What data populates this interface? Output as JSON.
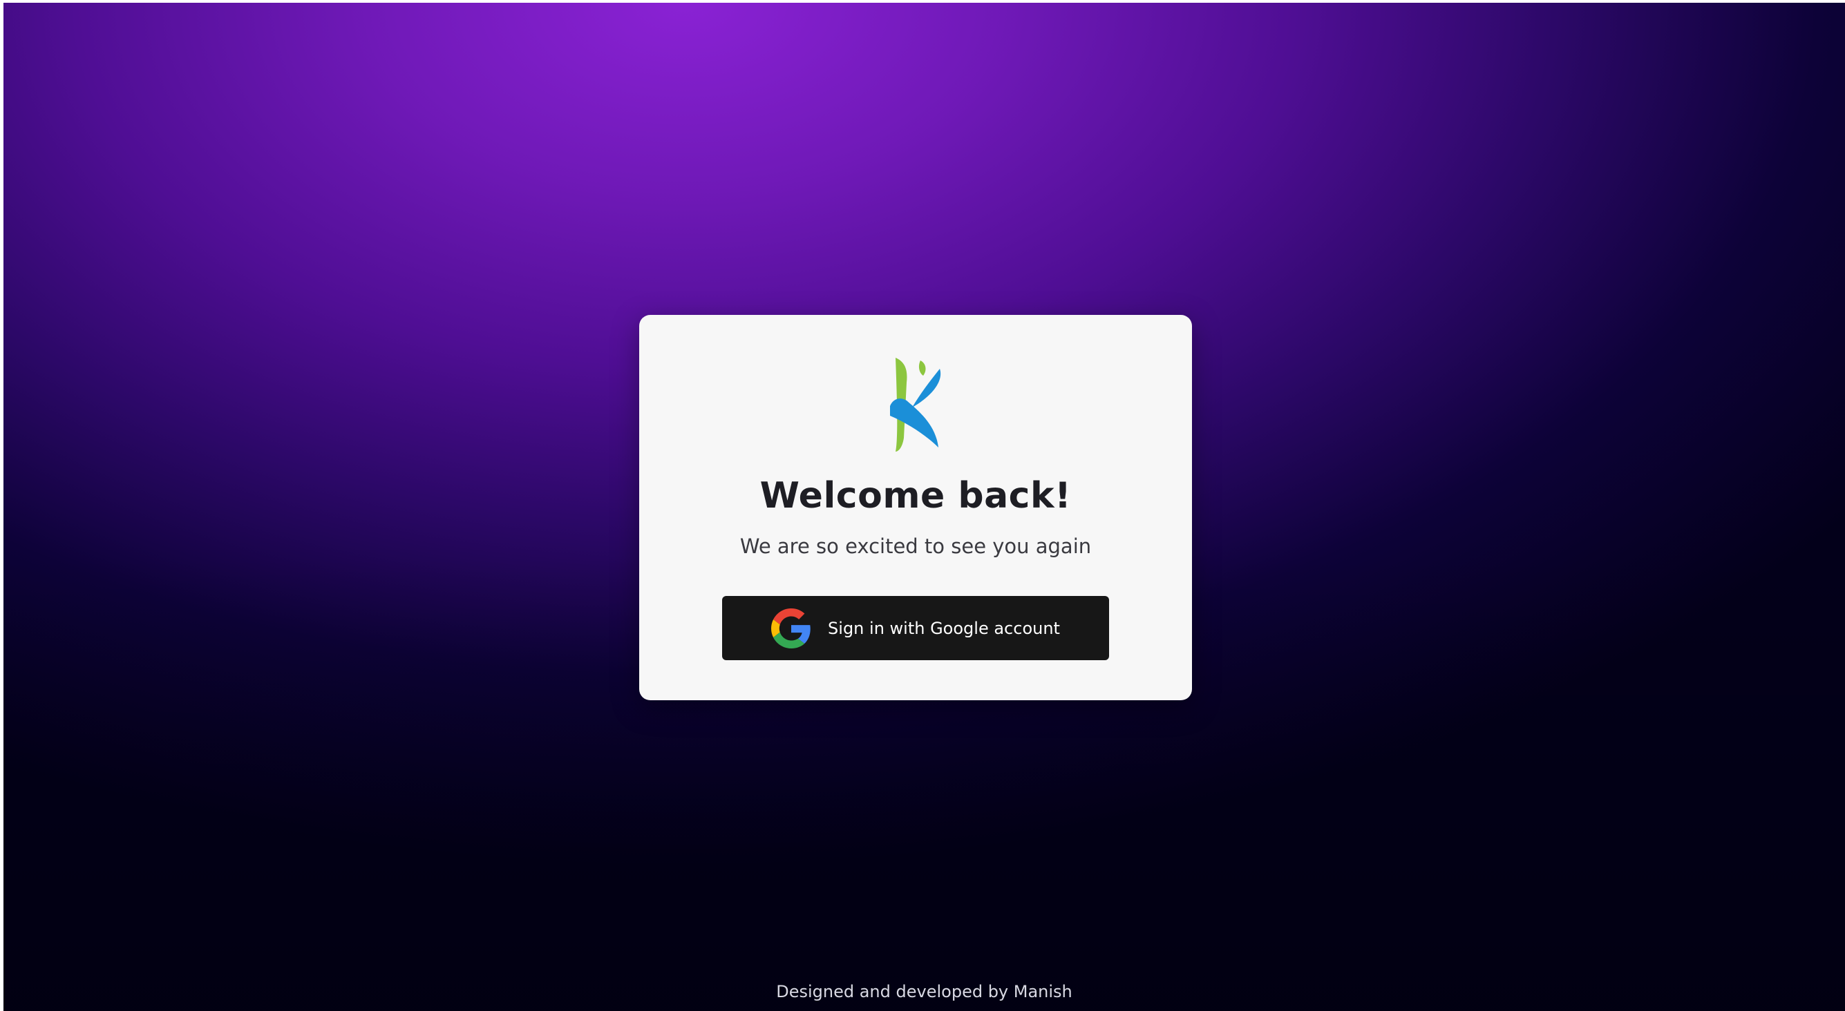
{
  "login": {
    "title": "Welcome back!",
    "subtitle": "We are so excited to see you again",
    "google_button_label": "Sign in with Google account"
  },
  "footer": {
    "credit": "Designed and developed by Manish"
  },
  "icons": {
    "logo": "app-logo-icon",
    "google": "google-g-icon"
  },
  "colors": {
    "background_top": "#8a22d4",
    "background_bottom": "#03001a",
    "card_background": "#f7f7f7",
    "button_background": "#171717",
    "logo_green": "#8cc63f",
    "logo_blue": "#1b8fd8",
    "google_blue": "#4285F4",
    "google_red": "#EA4335",
    "google_yellow": "#FBBC05",
    "google_green": "#34A853"
  }
}
